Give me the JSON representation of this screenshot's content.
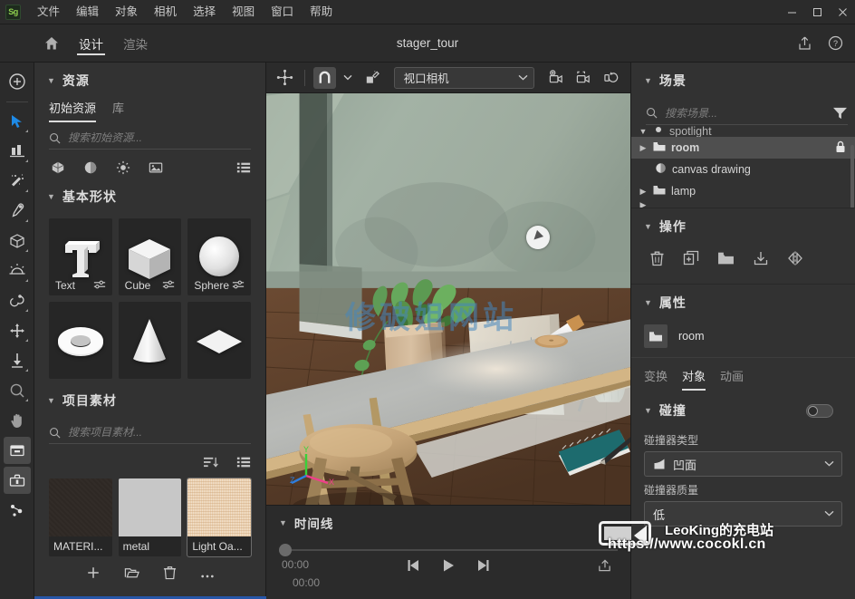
{
  "window": {
    "app_logo": "Sg",
    "menu": [
      "文件",
      "编辑",
      "对象",
      "相机",
      "选择",
      "视图",
      "窗口",
      "帮助"
    ],
    "controls": {
      "minimize": "minimize-icon",
      "maximize": "maximize-icon",
      "close": "close-icon"
    }
  },
  "header": {
    "home_icon": "home-icon",
    "tabs": [
      {
        "label": "设计",
        "active": true
      },
      {
        "label": "渲染",
        "active": false
      }
    ],
    "title": "stager_tour",
    "share_icon": "share-icon",
    "help_icon": "help-icon"
  },
  "rail": {
    "items": [
      {
        "name": "add-object-tool",
        "icon": "plus-circle-icon"
      },
      {
        "name": "select-tool",
        "icon": "cursor-arrow-icon",
        "active": true
      },
      {
        "name": "align-tool",
        "icon": "align-icon"
      },
      {
        "name": "magic-wand-tool",
        "icon": "magic-wand-icon"
      },
      {
        "name": "eyedropper-tool",
        "icon": "eyedropper-icon"
      },
      {
        "name": "model-tool",
        "icon": "cube-icon"
      },
      {
        "name": "light-tool",
        "icon": "sun-icon"
      },
      {
        "name": "physics-tool",
        "icon": "physics-icon"
      },
      {
        "name": "move-tool",
        "icon": "move-arrows-icon"
      },
      {
        "name": "drop-tool",
        "icon": "drop-down-arrow-icon"
      },
      {
        "name": "zoom-tool",
        "icon": "magnifier-icon"
      },
      {
        "name": "pan-tool",
        "icon": "hand-icon"
      },
      {
        "name": "library-panel",
        "icon": "archive-box-icon"
      },
      {
        "name": "toolbox-panel",
        "icon": "toolbox-icon"
      },
      {
        "name": "material-graph",
        "icon": "nodes-icon"
      }
    ]
  },
  "assets_panel": {
    "title": "资源",
    "tabs": [
      {
        "label": "初始资源",
        "active": true
      },
      {
        "label": "库",
        "active": false
      }
    ],
    "search_placeholder": "搜索初始资源...",
    "filters": [
      "model-filter-icon",
      "material-filter-icon",
      "light-filter-icon",
      "image-filter-icon"
    ],
    "list_view_icon": "list-view-icon",
    "shapes_title": "基本形状",
    "shapes": [
      {
        "label": "Text",
        "icon": "text-shape-thumb",
        "slider": "sliders-icon"
      },
      {
        "label": "Cube",
        "icon": "cube-shape-thumb",
        "slider": "sliders-icon"
      },
      {
        "label": "Sphere",
        "icon": "sphere-shape-thumb",
        "slider": "sliders-icon"
      },
      {
        "label": "",
        "icon": "torus-shape-thumb",
        "slider": ""
      },
      {
        "label": "",
        "icon": "cone-shape-thumb",
        "slider": ""
      },
      {
        "label": "",
        "icon": "plane-shape-thumb",
        "slider": ""
      }
    ]
  },
  "project_panel": {
    "title": "项目素材",
    "search_placeholder": "搜索项目素材...",
    "sort_icon": "sort-icon",
    "list_view_icon": "list-view-icon",
    "materials": [
      {
        "name": "MATERI...",
        "swatch": "#2e2824",
        "kind": "dark-material"
      },
      {
        "name": "metal",
        "swatch": "#c7c7c7",
        "kind": "metal-material"
      },
      {
        "name": "Light Oa...",
        "swatch": "#e7c8a8",
        "kind": "light-oak-material"
      }
    ],
    "actions": [
      "add-icon",
      "open-folder-icon",
      "delete-icon",
      "more-options-icon"
    ]
  },
  "viewport_toolbar": {
    "transform_gizmo_icon": "transform-gizmo-icon",
    "snap_icon": "magnet-snap-icon",
    "snap_active": true,
    "snap_dropdown_icon": "chevron-down-icon",
    "physics_icon": "object-physics-icon",
    "camera_value": "视口相机",
    "camera_dropdown_icon": "chevron-down-icon",
    "add_camera_icon": "add-camera-icon",
    "frame_camera_icon": "frame-camera-icon",
    "reset_camera_icon": "reset-camera-icon"
  },
  "viewport": {
    "watermark": "修破姐网站",
    "gizmo_axes": [
      {
        "label": "Y",
        "color": "#39d13a"
      },
      {
        "label": "X",
        "color": "#ef3f8a"
      },
      {
        "label": "Z",
        "color": "#2f7ddb"
      }
    ]
  },
  "timeline": {
    "title": "时间线",
    "time_start": "00:00",
    "time_end": "00:00",
    "controls": [
      "skip-back-icon",
      "play-icon",
      "skip-forward-icon"
    ],
    "export_icon": "export-icon",
    "watermark_line1": "LeoKing的充电站",
    "watermark_line2": "https://www.cocokl.cn"
  },
  "scene_panel": {
    "title": "场景",
    "search_placeholder": "搜索场景...",
    "filter_icon": "filter-icon",
    "items": [
      {
        "label": "spotlight",
        "icon": "light-icon",
        "expandable": true,
        "clipped": true,
        "selected": false,
        "locked": false,
        "indent": 0
      },
      {
        "label": "room",
        "icon": "folder-icon",
        "expandable": true,
        "clipped": false,
        "selected": true,
        "locked": true,
        "indent": 0
      },
      {
        "label": "canvas drawing",
        "icon": "model-icon",
        "expandable": false,
        "clipped": false,
        "selected": false,
        "locked": false,
        "indent": 1
      },
      {
        "label": "lamp",
        "icon": "folder-icon",
        "expandable": true,
        "clipped": false,
        "selected": false,
        "locked": false,
        "indent": 0
      }
    ]
  },
  "operations_panel": {
    "title": "操作",
    "actions": [
      {
        "name": "delete-object",
        "icon": "trash-icon"
      },
      {
        "name": "duplicate-object",
        "icon": "duplicate-icon"
      },
      {
        "name": "group-object",
        "icon": "folder-icon"
      },
      {
        "name": "import-object",
        "icon": "import-icon"
      },
      {
        "name": "mirror-object",
        "icon": "mirror-icon"
      }
    ]
  },
  "properties_panel": {
    "title": "属性",
    "object_icon": "folder-icon",
    "object_name": "room",
    "tabs": [
      {
        "label": "变换",
        "active": false
      },
      {
        "label": "对象",
        "active": true
      },
      {
        "label": "动画",
        "active": false
      }
    ],
    "collision": {
      "title": "碰撞",
      "enabled": false,
      "collider_type_label": "碰撞器类型",
      "collider_type_value": "凹面",
      "collider_type_icon": "concave-collider-icon",
      "collider_quality_label": "碰撞器质量",
      "collider_quality_value": "低"
    }
  },
  "colors": {
    "accent": "#1473e6",
    "panel_bg": "#323232",
    "chrome_bg": "#2b2b2b",
    "selection": "#4f4f4f",
    "watermark_blue": "#4687be"
  }
}
